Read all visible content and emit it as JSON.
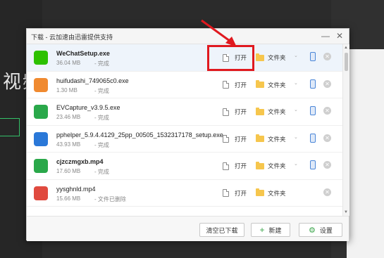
{
  "background": {
    "side_text": "视频"
  },
  "dialog": {
    "title": "下载 - 云加速由迅雷提供支持",
    "minimize_glyph": "—",
    "close_glyph": "✕"
  },
  "actions": {
    "open_label": "打开",
    "folder_label": "文件夹",
    "more_glyph": "⌄",
    "delete_glyph": "✕"
  },
  "files": [
    {
      "name": "WeChatSetup.exe",
      "size": "36.04 MB",
      "status": "- 完成",
      "icon": "wechat-icon",
      "icon_color": "#2dc100",
      "bold": true
    },
    {
      "name": "huifudashi_749065c0.exe",
      "size": "1.30 MB",
      "status": "- 完成",
      "icon": "recovery-icon",
      "icon_color": "#f08a30"
    },
    {
      "name": "EVCapture_v3.9.5.exe",
      "size": "23.46 MB",
      "status": "- 完成",
      "icon": "evcapture-icon",
      "icon_color": "#2aa84a"
    },
    {
      "name": "pphelper_5.9.4.4129_25pp_00505_1532317178_setup.exe",
      "size": "43.93 MB",
      "status": "- 完成",
      "icon": "pp-icon",
      "icon_color": "#2a78d8"
    },
    {
      "name": "cjzczmgxb.mp4",
      "size": "17.60 MB",
      "status": "- 完成",
      "icon": "video-icon",
      "icon_color": "#2aa84a",
      "bold": true
    },
    {
      "name": "yysghnld.mp4",
      "size": "15.66 MB",
      "status": "- 文件已删除",
      "icon": "error-file-icon",
      "icon_color": "#e04a3f"
    }
  ],
  "footer": {
    "clear_label": "清空已下载",
    "new_label": "新建",
    "new_glyph": "+",
    "settings_label": "设置",
    "settings_glyph": "⚙"
  }
}
